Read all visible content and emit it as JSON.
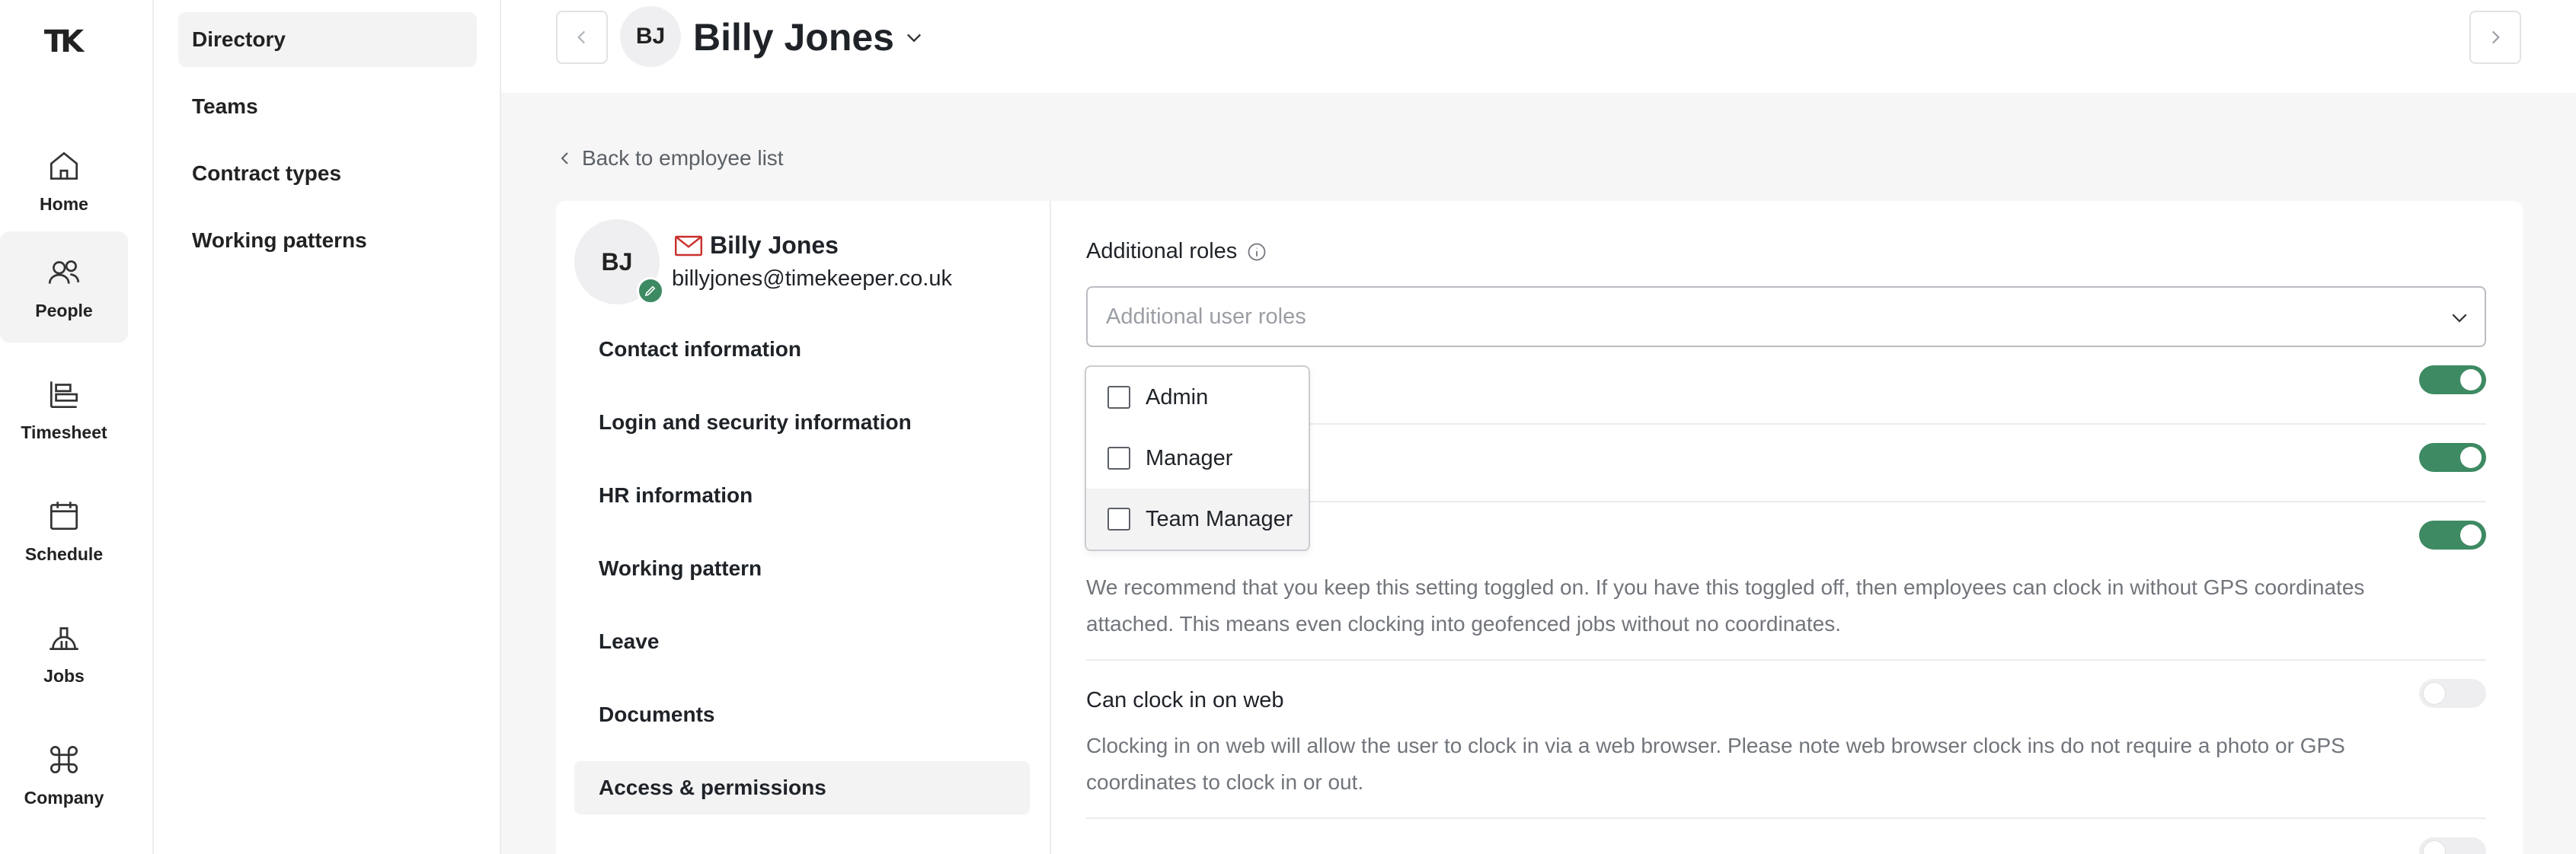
{
  "app": {
    "logo_text": "TK"
  },
  "rail": {
    "items": [
      {
        "label": "Home",
        "icon": "home-icon"
      },
      {
        "label": "People",
        "icon": "people-icon",
        "active": true
      },
      {
        "label": "Timesheet",
        "icon": "timesheet-icon"
      },
      {
        "label": "Schedule",
        "icon": "calendar-icon"
      },
      {
        "label": "Jobs",
        "icon": "jobs-icon"
      },
      {
        "label": "Company",
        "icon": "command-icon"
      }
    ]
  },
  "subnav": {
    "items": [
      {
        "label": "Directory",
        "active": true
      },
      {
        "label": "Teams"
      },
      {
        "label": "Contract types"
      },
      {
        "label": "Working patterns"
      }
    ]
  },
  "header": {
    "initials": "BJ",
    "employee_name": "Billy Jones"
  },
  "back_link": "Back to employee list",
  "profile": {
    "initials": "BJ",
    "name": "Billy Jones",
    "email": "billyjones@timekeeper.co.uk",
    "sections": [
      {
        "label": "Contact information"
      },
      {
        "label": "Login and security information"
      },
      {
        "label": "HR information"
      },
      {
        "label": "Working pattern"
      },
      {
        "label": "Leave"
      },
      {
        "label": "Documents"
      },
      {
        "label": "Access & permissions",
        "active": true
      }
    ]
  },
  "settings": {
    "additional_roles_label": "Additional roles",
    "additional_roles_placeholder": "Additional user roles",
    "toggles": [
      {
        "state": "on"
      },
      {
        "state": "on"
      },
      {
        "state": "on"
      },
      {
        "state": "off"
      },
      {
        "state": "off"
      }
    ],
    "gps_desc_line1": "We recommend that you keep this setting toggled on. If you have this toggled off, then employees can clock in without GPS coordinates",
    "gps_desc_line2": "attached. This means even clocking into geofenced jobs without no coordinates.",
    "web_title": "Can clock in on web",
    "web_desc_line1": "Clocking in on web will allow the user to clock in via a web browser. Please note web browser clock ins do not require a photo or GPS",
    "web_desc_line2": "coordinates to clock in or out."
  },
  "dropdown": {
    "options": [
      {
        "label": "Admin",
        "checked": false
      },
      {
        "label": "Manager",
        "checked": false
      },
      {
        "label": "Team Manager",
        "checked": false,
        "hover": true
      }
    ]
  },
  "colors": {
    "accent": "#3d8a63",
    "mail_icon": "#c9302c"
  }
}
